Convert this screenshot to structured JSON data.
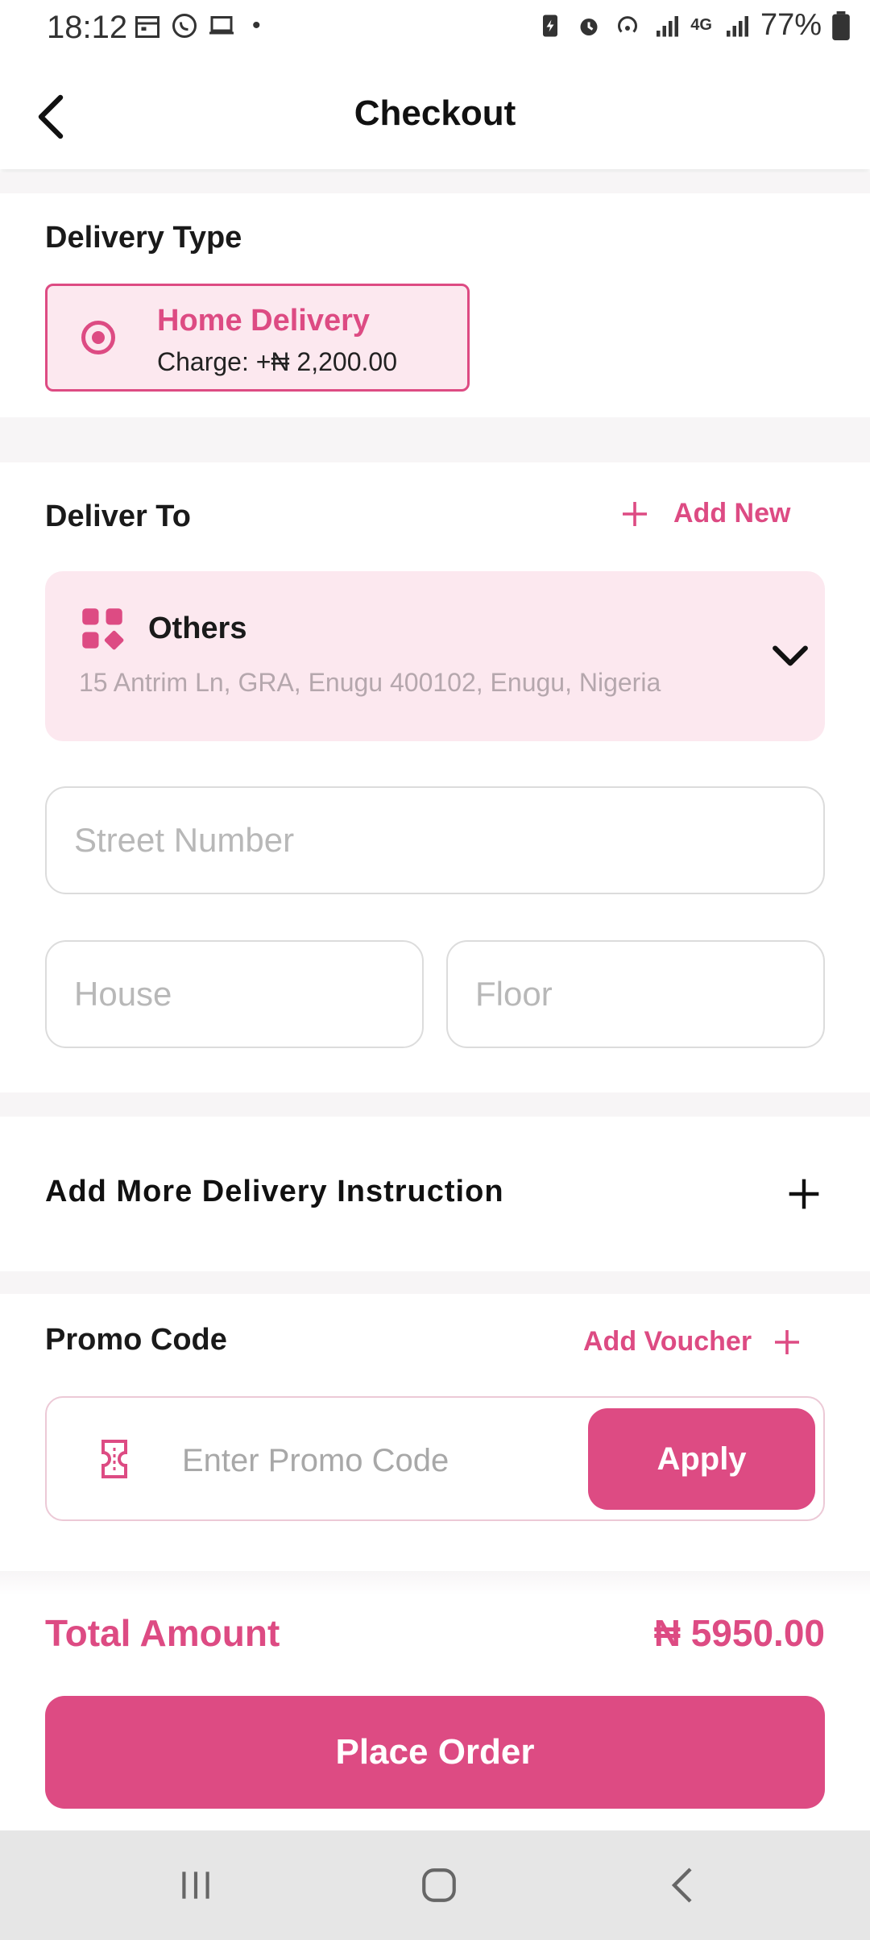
{
  "status_bar": {
    "time": "18:12",
    "battery": "77%",
    "network": "4G",
    "dot": "•"
  },
  "header": {
    "title": "Checkout"
  },
  "delivery_type": {
    "title": "Delivery Type",
    "option_name": "Home Delivery",
    "option_charge": "Charge: +₦ 2,200.00",
    "selected": true
  },
  "deliver_to": {
    "title": "Deliver To",
    "add_new_label": "Add New",
    "address_label": "Others",
    "address_text": "15 Antrim Ln, GRA, Enugu 400102, Enugu, Nigeria"
  },
  "fields": {
    "street_placeholder": "Street Number",
    "house_placeholder": "House",
    "floor_placeholder": "Floor"
  },
  "instructions": {
    "title": "Add More Delivery Instruction"
  },
  "promo": {
    "title": "Promo Code",
    "add_voucher_label": "Add Voucher",
    "placeholder": "Enter Promo Code",
    "apply_label": "Apply"
  },
  "footer": {
    "total_label": "Total Amount",
    "total_value": "₦ 5950.00",
    "place_order_label": "Place Order"
  },
  "colors": {
    "accent": "#dd4b83",
    "accent_light": "#fce8ef"
  }
}
